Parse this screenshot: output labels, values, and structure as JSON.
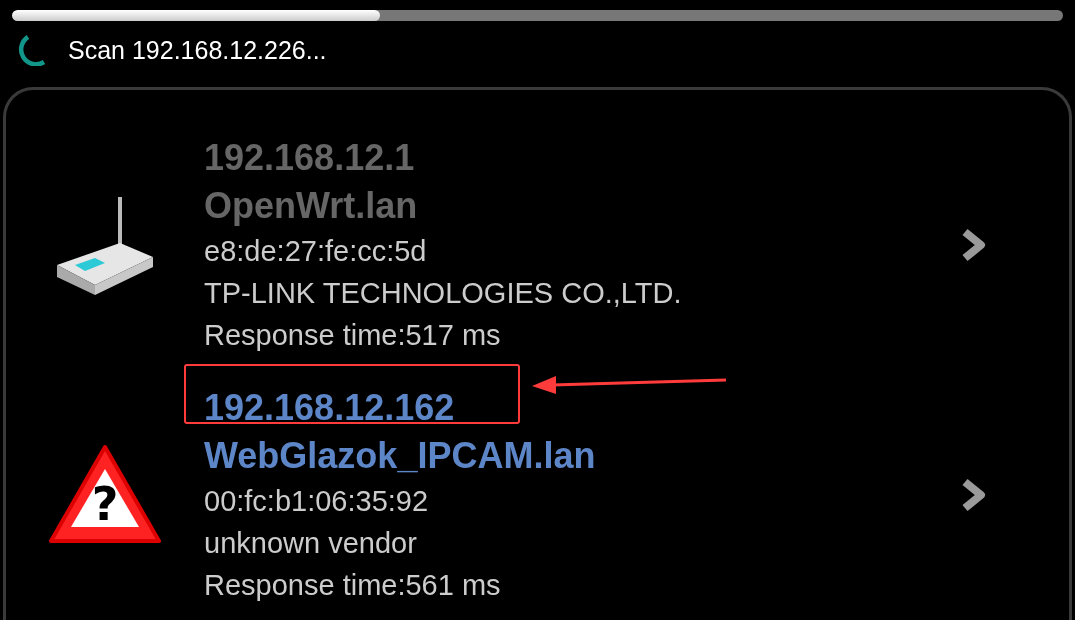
{
  "scan": {
    "level": 0.35,
    "status": "Scan 192.168.12.226..."
  },
  "devices": [
    {
      "kind": "router",
      "ip": "192.168.12.1",
      "hostname": "OpenWrt.lan",
      "mac": "e8:de:27:fe:cc:5d",
      "vendor": "TP-LINK TECHNOLOGIES CO.,LTD.",
      "response": "Response time:517 ms",
      "highlighted": false
    },
    {
      "kind": "unknown",
      "icon_glyph": "?",
      "ip": "192.168.12.162",
      "hostname": "WebGlazok_IPCAM.lan",
      "mac": "00:fc:b1:06:35:92",
      "vendor": "unknown vendor",
      "response": "Response time:561 ms",
      "highlighted": true
    }
  ]
}
